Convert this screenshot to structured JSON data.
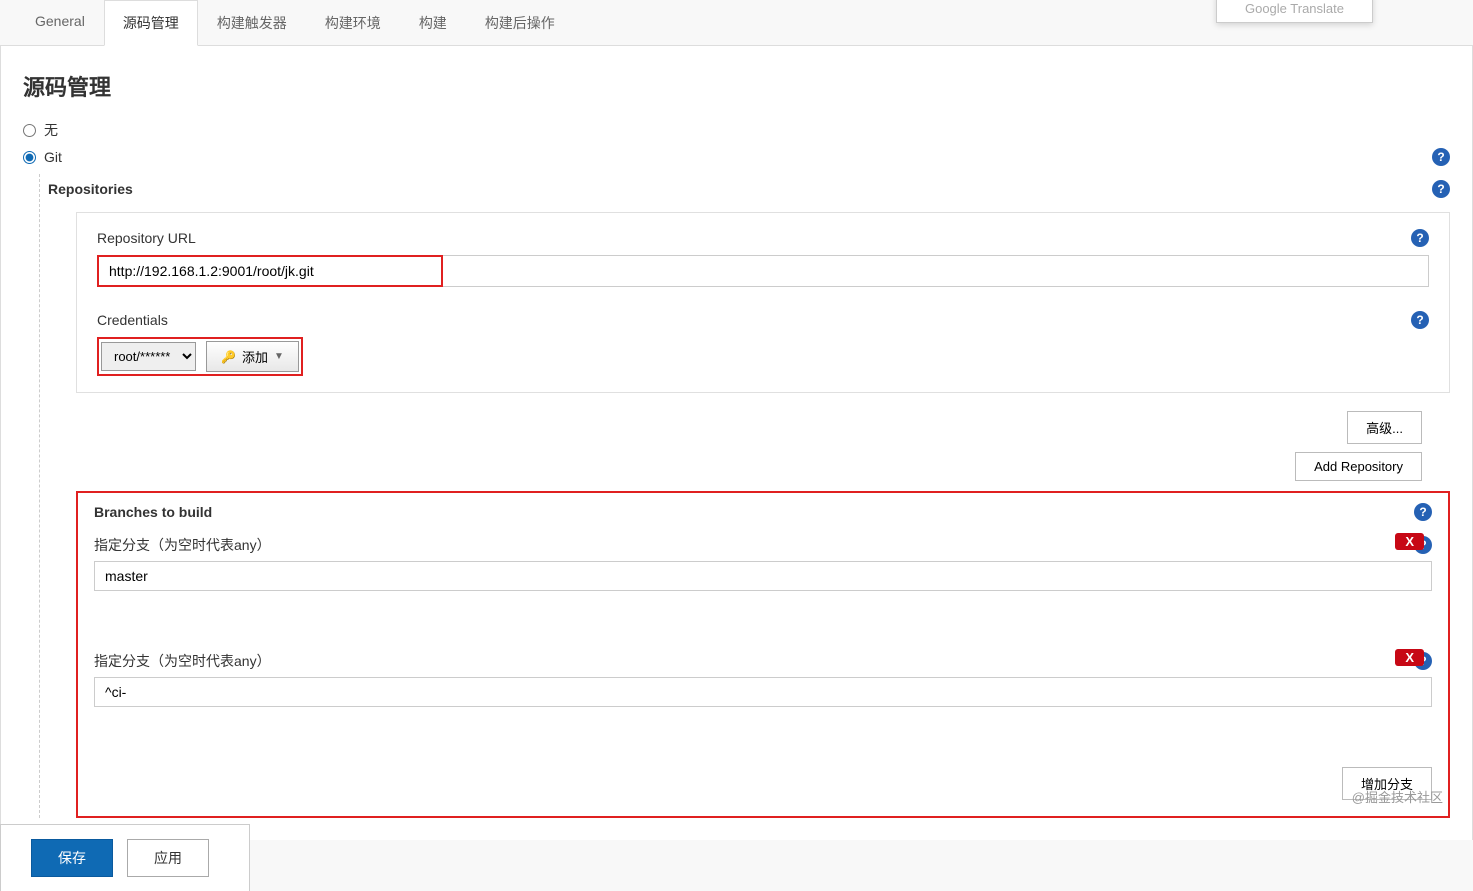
{
  "tabs": [
    "General",
    "源码管理",
    "构建触发器",
    "构建环境",
    "构建",
    "构建后操作"
  ],
  "active_tab_index": 1,
  "section_title": "源码管理",
  "scm": {
    "none_label": "无",
    "git_label": "Git",
    "selected": "git"
  },
  "repositories_label": "Repositories",
  "repo": {
    "url_label": "Repository URL",
    "url_value": "http://192.168.1.2:9001/root/jk.git",
    "credentials_label": "Credentials",
    "credentials_selected": "root/******",
    "add_cred_label": "添加",
    "advanced_label": "高级...",
    "add_repo_label": "Add Repository"
  },
  "branches": {
    "section_label": "Branches to build",
    "field_label": "指定分支（为空时代表any）",
    "entries": [
      {
        "value": "master"
      },
      {
        "value": "^ci-"
      }
    ],
    "delete_label": "X",
    "add_branch_label": "增加分支"
  },
  "footer": {
    "save": "保存",
    "apply": "应用"
  },
  "translate_flap": "Google Translate",
  "watermark": "@掘金技术社区"
}
